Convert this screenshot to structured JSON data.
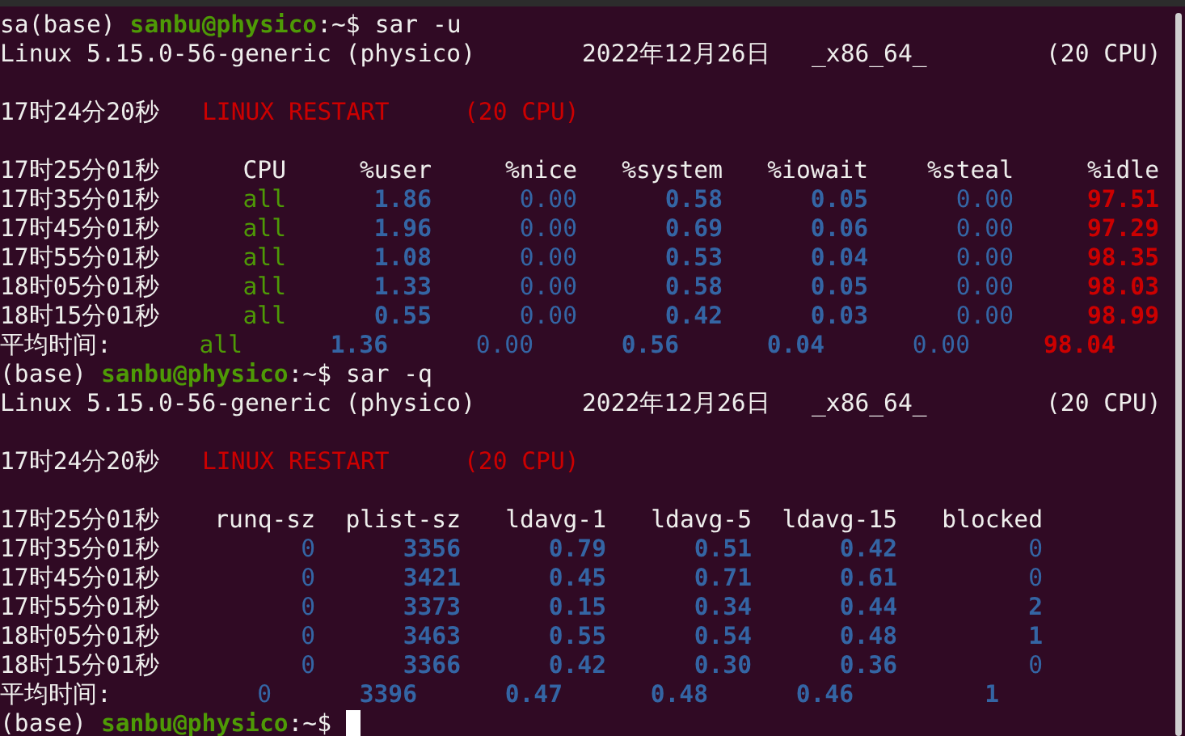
{
  "sessions": [
    {
      "prompt": {
        "prefix": "sa(base)",
        "user_host": "sanbu@physico",
        "path": ":~$",
        "command": "sar -u"
      },
      "system_info": {
        "kernel": "Linux 5.15.0-56-generic (physico)",
        "date": "2022年12月26日",
        "arch": "_x86_64_",
        "cpus": "(20 CPU)"
      },
      "restart": {
        "time": "17时24分20秒",
        "label": "LINUX RESTART",
        "cpus": "(20 CPU)"
      },
      "table": {
        "header_time": "17时25分01秒",
        "columns": [
          "CPU",
          "%user",
          "%nice",
          "%system",
          "%iowait",
          "%steal",
          "%idle"
        ],
        "rows": [
          {
            "time": "17时35分01秒",
            "cells": [
              {
                "text": "all",
                "kind": "label"
              },
              {
                "text": "1.86",
                "kind": "value"
              },
              {
                "text": "0.00",
                "kind": "zero"
              },
              {
                "text": "0.58",
                "kind": "value"
              },
              {
                "text": "0.05",
                "kind": "value"
              },
              {
                "text": "0.00",
                "kind": "zero"
              },
              {
                "text": "97.51",
                "kind": "high"
              }
            ]
          },
          {
            "time": "17时45分01秒",
            "cells": [
              {
                "text": "all",
                "kind": "label"
              },
              {
                "text": "1.96",
                "kind": "value"
              },
              {
                "text": "0.00",
                "kind": "zero"
              },
              {
                "text": "0.69",
                "kind": "value"
              },
              {
                "text": "0.06",
                "kind": "value"
              },
              {
                "text": "0.00",
                "kind": "zero"
              },
              {
                "text": "97.29",
                "kind": "high"
              }
            ]
          },
          {
            "time": "17时55分01秒",
            "cells": [
              {
                "text": "all",
                "kind": "label"
              },
              {
                "text": "1.08",
                "kind": "value"
              },
              {
                "text": "0.00",
                "kind": "zero"
              },
              {
                "text": "0.53",
                "kind": "value"
              },
              {
                "text": "0.04",
                "kind": "value"
              },
              {
                "text": "0.00",
                "kind": "zero"
              },
              {
                "text": "98.35",
                "kind": "high"
              }
            ]
          },
          {
            "time": "18时05分01秒",
            "cells": [
              {
                "text": "all",
                "kind": "label"
              },
              {
                "text": "1.33",
                "kind": "value"
              },
              {
                "text": "0.00",
                "kind": "zero"
              },
              {
                "text": "0.58",
                "kind": "value"
              },
              {
                "text": "0.05",
                "kind": "value"
              },
              {
                "text": "0.00",
                "kind": "zero"
              },
              {
                "text": "98.03",
                "kind": "high"
              }
            ]
          },
          {
            "time": "18时15分01秒",
            "cells": [
              {
                "text": "all",
                "kind": "label"
              },
              {
                "text": "0.55",
                "kind": "value"
              },
              {
                "text": "0.00",
                "kind": "zero"
              },
              {
                "text": "0.42",
                "kind": "value"
              },
              {
                "text": "0.03",
                "kind": "value"
              },
              {
                "text": "0.00",
                "kind": "zero"
              },
              {
                "text": "98.99",
                "kind": "high"
              }
            ]
          }
        ],
        "average": {
          "label": "平均时间:",
          "cells": [
            {
              "text": "all",
              "kind": "label"
            },
            {
              "text": "1.36",
              "kind": "value"
            },
            {
              "text": "0.00",
              "kind": "zero"
            },
            {
              "text": "0.56",
              "kind": "value"
            },
            {
              "text": "0.04",
              "kind": "value"
            },
            {
              "text": "0.00",
              "kind": "zero"
            },
            {
              "text": "98.04",
              "kind": "high"
            }
          ]
        }
      }
    },
    {
      "prompt": {
        "prefix": "(base)",
        "user_host": "sanbu@physico",
        "path": ":~$",
        "command": "sar -q"
      },
      "system_info": {
        "kernel": "Linux 5.15.0-56-generic (physico)",
        "date": "2022年12月26日",
        "arch": "_x86_64_",
        "cpus": "(20 CPU)"
      },
      "restart": {
        "time": "17时24分20秒",
        "label": "LINUX RESTART",
        "cpus": "(20 CPU)"
      },
      "table": {
        "header_time": "17时25分01秒",
        "columns": [
          "runq-sz",
          "plist-sz",
          "ldavg-1",
          "ldavg-5",
          "ldavg-15",
          "blocked"
        ],
        "rows": [
          {
            "time": "17时35分01秒",
            "cells": [
              {
                "text": "0",
                "kind": "zero"
              },
              {
                "text": "3356",
                "kind": "value"
              },
              {
                "text": "0.79",
                "kind": "value"
              },
              {
                "text": "0.51",
                "kind": "value"
              },
              {
                "text": "0.42",
                "kind": "value"
              },
              {
                "text": "0",
                "kind": "zero"
              }
            ]
          },
          {
            "time": "17时45分01秒",
            "cells": [
              {
                "text": "0",
                "kind": "zero"
              },
              {
                "text": "3421",
                "kind": "value"
              },
              {
                "text": "0.45",
                "kind": "value"
              },
              {
                "text": "0.71",
                "kind": "value"
              },
              {
                "text": "0.61",
                "kind": "value"
              },
              {
                "text": "0",
                "kind": "zero"
              }
            ]
          },
          {
            "time": "17时55分01秒",
            "cells": [
              {
                "text": "0",
                "kind": "zero"
              },
              {
                "text": "3373",
                "kind": "value"
              },
              {
                "text": "0.15",
                "kind": "value"
              },
              {
                "text": "0.34",
                "kind": "value"
              },
              {
                "text": "0.44",
                "kind": "value"
              },
              {
                "text": "2",
                "kind": "value"
              }
            ]
          },
          {
            "time": "18时05分01秒",
            "cells": [
              {
                "text": "0",
                "kind": "zero"
              },
              {
                "text": "3463",
                "kind": "value"
              },
              {
                "text": "0.55",
                "kind": "value"
              },
              {
                "text": "0.54",
                "kind": "value"
              },
              {
                "text": "0.48",
                "kind": "value"
              },
              {
                "text": "1",
                "kind": "value"
              }
            ]
          },
          {
            "time": "18时15分01秒",
            "cells": [
              {
                "text": "0",
                "kind": "zero"
              },
              {
                "text": "3366",
                "kind": "value"
              },
              {
                "text": "0.42",
                "kind": "value"
              },
              {
                "text": "0.30",
                "kind": "value"
              },
              {
                "text": "0.36",
                "kind": "value"
              },
              {
                "text": "0",
                "kind": "zero"
              }
            ]
          }
        ],
        "average": {
          "label": "平均时间:",
          "cells": [
            {
              "text": "0",
              "kind": "zero"
            },
            {
              "text": "3396",
              "kind": "value"
            },
            {
              "text": "0.47",
              "kind": "value"
            },
            {
              "text": "0.48",
              "kind": "value"
            },
            {
              "text": "0.46",
              "kind": "value"
            },
            {
              "text": "1",
              "kind": "value"
            }
          ]
        }
      }
    }
  ],
  "final_prompt": {
    "prefix": "(base)",
    "user_host": "sanbu@physico",
    "path": ":~$",
    "cursor": true
  }
}
